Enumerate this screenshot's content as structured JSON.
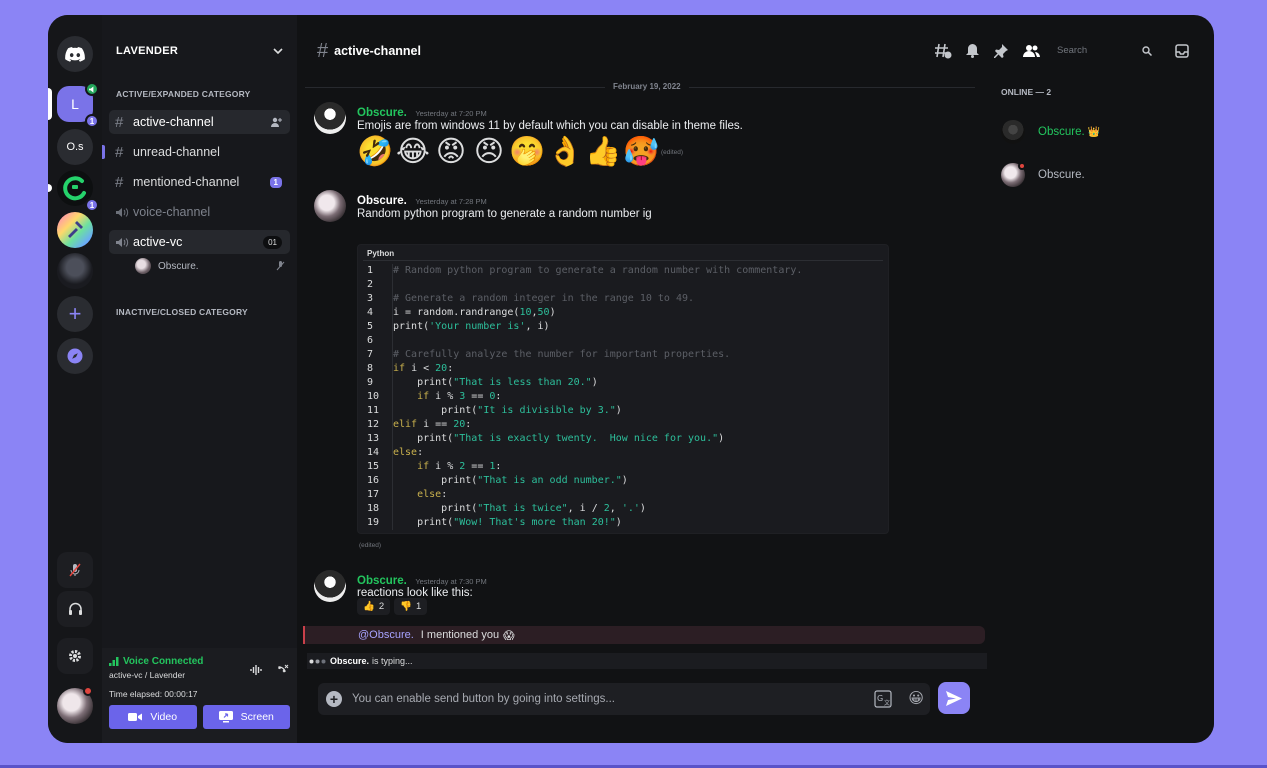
{
  "server": {
    "name": "LAVENDER",
    "icons": [
      {
        "label": "",
        "icon": "discord-icon"
      },
      {
        "label": "L",
        "badge": "1"
      },
      {
        "label": "O.s"
      },
      {
        "label": "",
        "badge": "1"
      },
      {
        "label": ""
      },
      {
        "label": ""
      },
      {
        "label": "+",
        "icon": "add-server-icon"
      },
      {
        "label": "",
        "icon": "compass-icon"
      }
    ]
  },
  "categories": {
    "active": "ACTIVE/EXPANDED CATEGORY",
    "inactive": "INACTIVE/CLOSED CATEGORY"
  },
  "channels": [
    {
      "name": "active-channel",
      "state": "active"
    },
    {
      "name": "unread-channel",
      "state": "unread"
    },
    {
      "name": "mentioned-channel",
      "state": "mentioned",
      "badge": "1"
    },
    {
      "name": "voice-channel",
      "state": "voice"
    },
    {
      "name": "active-vc",
      "state": "active-voice",
      "count": "01"
    }
  ],
  "voice_user": "Obscure.",
  "voice_panel": {
    "title": "Voice Connected",
    "subtitle": "active-vc / Lavender",
    "elapsed": "Time elapsed: 00:00:17",
    "video_label": "Video",
    "screen_label": "Screen"
  },
  "header": {
    "channel_name": "active-channel",
    "search_placeholder": "Search"
  },
  "date_divider": "February 19, 2022",
  "messages": [
    {
      "author": "Obscure.",
      "timestamp": "Yesterday at 7:20 PM",
      "text": "Emojis are from windows 11 by default which you can disable in theme files.",
      "emojis": [
        "🤣",
        "😂",
        "😡",
        "😠",
        "🤭",
        "👌",
        "👍",
        "🥵"
      ],
      "edited": "(edited)"
    },
    {
      "author": "Obscure.",
      "timestamp": "Yesterday at 7:28 PM",
      "text": "Random python program to generate a random number ig",
      "code_language": "Python",
      "edited": "(edited)"
    },
    {
      "author": "Obscure.",
      "timestamp": "Yesterday at 7:30 PM",
      "text": "reactions look like this:",
      "reactions": [
        {
          "emoji": "👍",
          "count": "2"
        },
        {
          "emoji": "👎",
          "count": "1"
        }
      ]
    }
  ],
  "code_lines": [
    {
      "n": "1",
      "t": "# Random python program to generate a random number with commentary."
    },
    {
      "n": "2",
      "t": ""
    },
    {
      "n": "3",
      "t": "# Generate a random integer in the range 10 to 49."
    },
    {
      "n": "4",
      "t": "i = random.randrange(10,50)"
    },
    {
      "n": "5",
      "t": "print('Your number is', i)"
    },
    {
      "n": "6",
      "t": ""
    },
    {
      "n": "7",
      "t": "# Carefully analyze the number for important properties."
    },
    {
      "n": "8",
      "t": "if i < 20:"
    },
    {
      "n": "9",
      "t": "    print(\"That is less than 20.\")"
    },
    {
      "n": "10",
      "t": "    if i % 3 == 0:"
    },
    {
      "n": "11",
      "t": "        print(\"It is divisible by 3.\")"
    },
    {
      "n": "12",
      "t": "elif i == 20:"
    },
    {
      "n": "13",
      "t": "    print(\"That is exactly twenty.  How nice for you.\")"
    },
    {
      "n": "14",
      "t": "else:"
    },
    {
      "n": "15",
      "t": "    if i % 2 == 1:"
    },
    {
      "n": "16",
      "t": "        print(\"That is an odd number.\")"
    },
    {
      "n": "17",
      "t": "    else:"
    },
    {
      "n": "18",
      "t": "        print(\"That is twice\", i / 2, '.')"
    },
    {
      "n": "19",
      "t": "    print(\"Wow! That's more than 20!\")"
    }
  ],
  "mention": {
    "user": "@Obscure.",
    "text": "I mentioned you",
    "emoji": "😱"
  },
  "typing": {
    "user": "Obscure.",
    "text": "is typing..."
  },
  "composer": {
    "placeholder": "You can enable send button by going into settings..."
  },
  "members": {
    "header": "ONLINE — 2",
    "list": [
      {
        "name": "Obscure.",
        "crown": "👑"
      },
      {
        "name": "Obscure."
      }
    ]
  },
  "colors": {
    "accent": "#8b84f5",
    "online_name": "#23c55e",
    "background": "#111214",
    "mention_bar": "#c9404a"
  }
}
